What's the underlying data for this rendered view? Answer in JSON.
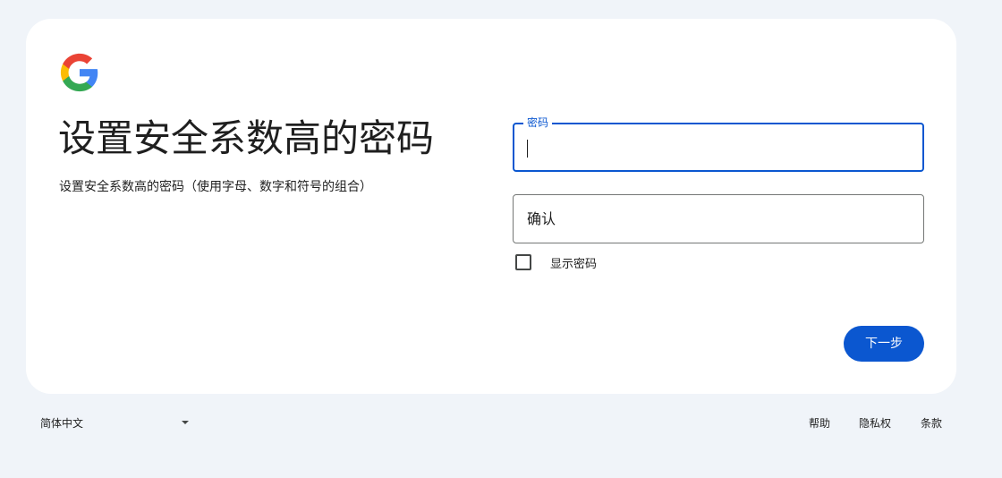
{
  "logo": {
    "icon": "google-g-icon",
    "colors": [
      "#4285f4",
      "#ea4335",
      "#fbbc05",
      "#34a853"
    ]
  },
  "heading": {
    "title": "设置安全系数高的密码",
    "subtitle": "设置安全系数高的密码（使用字母、数字和符号的组合）"
  },
  "form": {
    "password": {
      "label": "密码",
      "value": "",
      "focused": true
    },
    "confirm": {
      "placeholder": "确认",
      "value": ""
    },
    "show_password": {
      "label": "显示密码",
      "checked": false
    },
    "next_button": "下一步"
  },
  "footer": {
    "language": "简体中文",
    "links": {
      "help": "帮助",
      "privacy": "隐私权",
      "terms": "条款"
    }
  },
  "colors": {
    "accent": "#0b57d0",
    "background": "#f0f4f9",
    "card": "#ffffff",
    "text": "#1f1f1f"
  }
}
